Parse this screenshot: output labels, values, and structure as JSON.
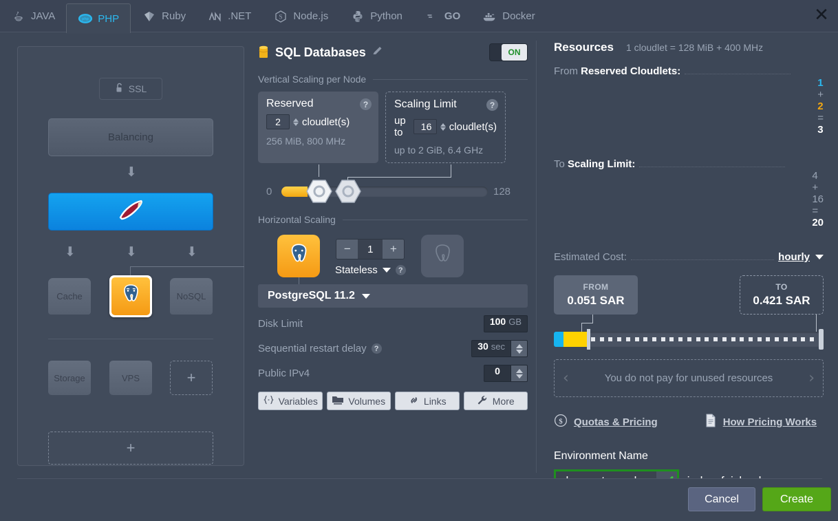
{
  "tabs": [
    {
      "label": "JAVA",
      "icon": "java-icon",
      "active": false
    },
    {
      "label": "PHP",
      "icon": "php-icon",
      "active": true
    },
    {
      "label": "Ruby",
      "icon": "ruby-icon",
      "active": false
    },
    {
      "label": ".NET",
      "icon": "dotnet-icon",
      "active": false
    },
    {
      "label": "Node.js",
      "icon": "nodejs-icon",
      "active": false
    },
    {
      "label": "Python",
      "icon": "python-icon",
      "active": false
    },
    {
      "label": "GO",
      "icon": "go-icon",
      "active": false
    },
    {
      "label": "Docker",
      "icon": "docker-icon",
      "active": false
    }
  ],
  "close_label": "✕",
  "topology": {
    "ssl_label": "SSL",
    "ssl_icon": "unlocked-padlock-icon",
    "balancing_label": "Balancing",
    "app_node_icon": "php-elephpant-icon",
    "arrow_glyph": "⬇",
    "db_tiles": [
      {
        "label": "Cache",
        "name": "cache"
      },
      {
        "label": "",
        "name": "postgresql",
        "icon": "postgresql-icon",
        "selected": true
      },
      {
        "label": "NoSQL",
        "name": "nosql"
      }
    ],
    "extra_tiles": [
      {
        "label": "Storage",
        "name": "storage"
      },
      {
        "label": "VPS",
        "name": "vps"
      },
      {
        "label": "+",
        "name": "add-tile"
      }
    ],
    "big_add_label": "+"
  },
  "center": {
    "title": "SQL Databases",
    "title_icon": "database-cylinder-icon",
    "edit_icon": "pencil-icon",
    "toggle_label": "ON",
    "vertical_section": "Vertical Scaling per Node",
    "reserved": {
      "title": "Reserved",
      "value": "2",
      "unit": "cloudlet(s)",
      "sub": "256 MiB, 800 MHz",
      "help": "?"
    },
    "scaling_limit": {
      "title": "Scaling Limit",
      "prefix": "up to",
      "value": "16",
      "unit": "cloudlet(s)",
      "sub_prefix": "up to",
      "sub": "2 GiB, 6.4 GHz",
      "help": "?"
    },
    "slider_min": "0",
    "slider_max": "128",
    "horizontal_section": "Horizontal Scaling",
    "node_count": "1",
    "minus_label": "−",
    "plus_label": "+",
    "mode_label": "Stateless",
    "mode_help": "?",
    "version_label": "PostgreSQL 11.2",
    "rows": [
      {
        "label": "Disk Limit",
        "value": "100",
        "unit": "GB",
        "spinner": false,
        "help": false
      },
      {
        "label": "Sequential restart delay",
        "value": "30",
        "unit": "sec",
        "spinner": true,
        "help": true
      },
      {
        "label": "Public IPv4",
        "value": "0",
        "unit": "",
        "spinner": true,
        "help": false
      }
    ],
    "buttons": [
      {
        "label": "Variables",
        "icon": "braces-icon"
      },
      {
        "label": "Volumes",
        "icon": "volumes-icon"
      },
      {
        "label": "Links",
        "icon": "chain-link-icon"
      },
      {
        "label": "More",
        "icon": "wrench-icon"
      }
    ]
  },
  "right": {
    "title": "Resources",
    "note": "1 cloudlet = 128 MiB + 400 MHz",
    "reserved_row": {
      "label_plain": "From ",
      "label_bold": "Reserved Cloudlets:",
      "a": "1",
      "op1": "+",
      "b": "2",
      "eq": "=",
      "total": "3"
    },
    "limit_row": {
      "label_plain": "To ",
      "label_bold": "Scaling Limit:",
      "a": "4",
      "op1": "+",
      "b": "16",
      "eq": "=",
      "total": "20"
    },
    "cost_row": {
      "label": "Estimated Cost:",
      "period": "hourly"
    },
    "cost_from": {
      "caption": "FROM",
      "value": "0.051 SAR"
    },
    "cost_to": {
      "caption": "TO",
      "value": "0.421 SAR"
    },
    "carousel_message": "You do not pay for unused resources",
    "carousel_prev": "‹",
    "carousel_next": "›",
    "links": [
      {
        "label": "Quotas & Pricing",
        "icon": "dollar-circle-icon"
      },
      {
        "label": "How Pricing Works",
        "icon": "document-icon"
      }
    ],
    "env_label": "Environment Name",
    "env_value": "php-postgresql",
    "env_placeholder": "Environment Name",
    "env_valid_icon": "green-check-icon",
    "env_suffix": ".jed.wafaicloud.com"
  },
  "footer": {
    "cancel_label": "Cancel",
    "create_label": "Create"
  },
  "colors": {
    "accent_blue": "#2bb8ef",
    "accent_gold": "#f2a711",
    "create_green": "#55a718",
    "valid_green": "#1f8f1f",
    "panel_bg": "#3d4757"
  }
}
